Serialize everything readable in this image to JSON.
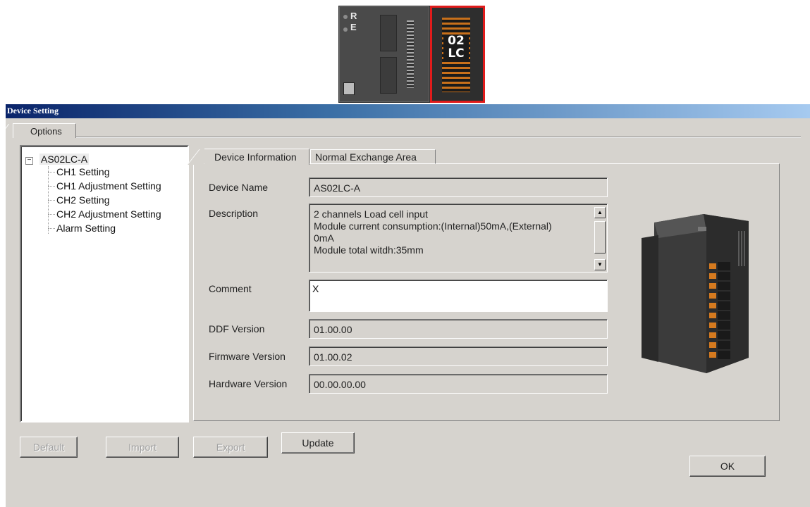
{
  "module_graphic": {
    "cpu_letters": [
      "R",
      "E"
    ],
    "module_label": [
      "02",
      "LC"
    ]
  },
  "dialog": {
    "title": "Device Setting",
    "options_tab": "Options"
  },
  "tree": {
    "root": "AS02LC-A",
    "expand_glyph": "−",
    "children": [
      "CH1 Setting",
      "CH1 Adjustment Setting",
      "CH2 Setting",
      "CH2 Adjustment Setting",
      "Alarm Setting"
    ]
  },
  "tabs": {
    "device_information": "Device Information",
    "normal_exchange_area": "Normal Exchange Area"
  },
  "fields": {
    "device_name_label": "Device Name",
    "device_name": "AS02LC-A",
    "description_label": "Description",
    "description": "2 channels Load cell input\nModule current consumption:(Internal)50mA,(External)\n0mA\nModule total witdh:35mm",
    "comment_label": "Comment",
    "comment": "X",
    "ddf_version_label": "DDF Version",
    "ddf_version": "01.00.00",
    "firmware_version_label": "Firmware Version",
    "firmware_version": "01.00.02",
    "hardware_version_label": "Hardware Version",
    "hardware_version": "00.00.00.00"
  },
  "buttons": {
    "default": "Default",
    "import": "Import",
    "export": "Export",
    "update": "Update",
    "ok": "OK"
  },
  "colors": {
    "dialog_bg": "#d6d3ce",
    "titlebar_start": "#0a246a",
    "titlebar_end": "#a6caf0",
    "highlight_red": "#e01b1b"
  }
}
